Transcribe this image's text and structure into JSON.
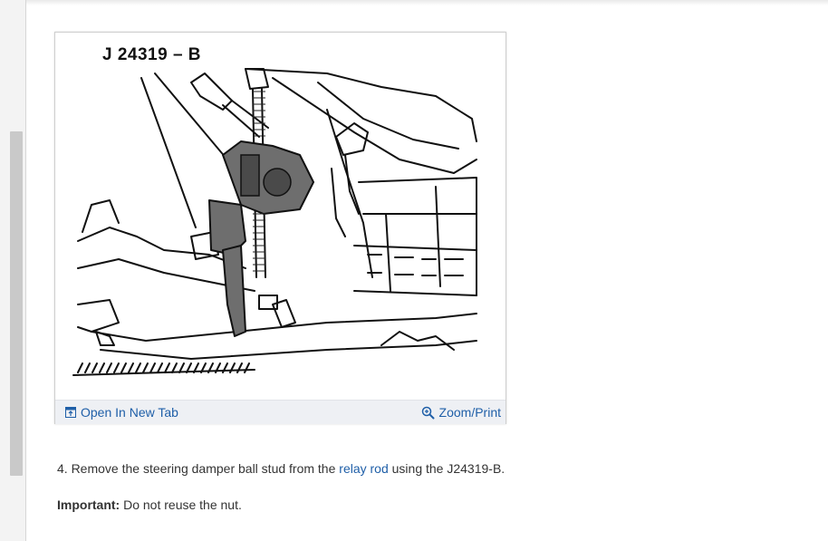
{
  "figure": {
    "label": "J 24319 – B",
    "open_new_tab_label": "Open In New Tab",
    "zoom_print_label": "Zoom/Print",
    "open_tab_icon": "open-new-tab-icon",
    "zoom_icon": "magnifier-plus-icon"
  },
  "content": {
    "step_prefix": "4. Remove the steering damper ball stud from the ",
    "step_link": "relay rod",
    "step_suffix": " using the J24319-B.",
    "important_label": "Important:",
    "important_text": " Do not reuse the nut."
  },
  "colors": {
    "link": "#1f5fa8",
    "toolbar_bg": "#eef0f4",
    "text": "#333333"
  }
}
